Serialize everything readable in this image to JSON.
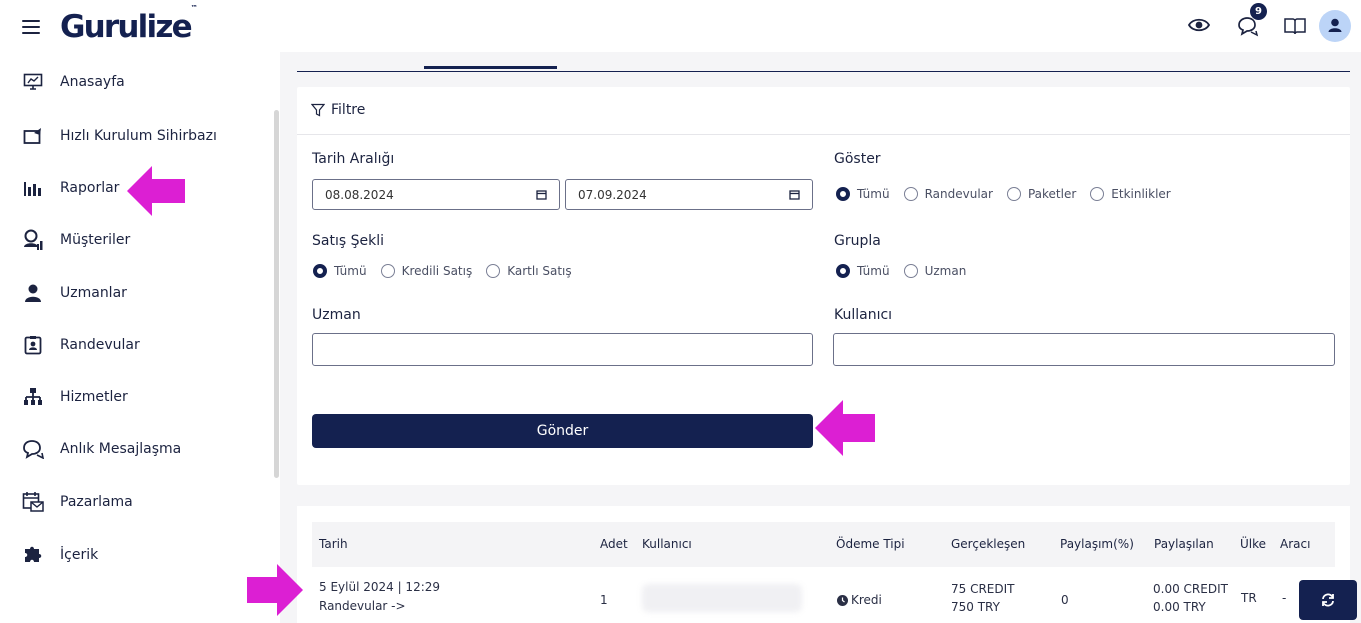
{
  "app": {
    "logo": "Gurulize",
    "logo_tm": "™",
    "notification_count": "9"
  },
  "sidebar": {
    "items": [
      {
        "label": "Anasayfa",
        "icon": "monitor-chart-icon"
      },
      {
        "label": "Hızlı Kurulum Sihirbazı",
        "icon": "setup-wizard-icon"
      },
      {
        "label": "Raporlar",
        "icon": "bar-chart-icon"
      },
      {
        "label": "Müşteriler",
        "icon": "customers-icon"
      },
      {
        "label": "Uzmanlar",
        "icon": "expert-user-icon"
      },
      {
        "label": "Randevular",
        "icon": "appointment-badge-icon"
      },
      {
        "label": "Hizmetler",
        "icon": "hierarchy-icon"
      },
      {
        "label": "Anlık Mesajlaşma",
        "icon": "chat-bubble-icon"
      },
      {
        "label": "Pazarlama",
        "icon": "calendar-mail-icon"
      },
      {
        "label": "İçerik",
        "icon": "puzzle-icon"
      }
    ]
  },
  "filter": {
    "title": "Filtre",
    "date_range_label": "Tarih Aralığı",
    "date_start": "08.08.2024",
    "date_end": "07.09.2024",
    "show_label": "Göster",
    "show_options": [
      "Tümü",
      "Randevular",
      "Paketler",
      "Etkinlikler"
    ],
    "show_selected": "Tümü",
    "sale_type_label": "Satış Şekli",
    "sale_type_options": [
      "Tümü",
      "Kredili Satış",
      "Kartlı Satış"
    ],
    "sale_type_selected": "Tümü",
    "group_label": "Grupla",
    "group_options": [
      "Tümü",
      "Uzman"
    ],
    "group_selected": "Tümü",
    "expert_label": "Uzman",
    "expert_value": "",
    "user_label": "Kullanıcı",
    "user_value": "",
    "submit_label": "Gönder"
  },
  "table": {
    "columns": [
      "Tarih",
      "Adet",
      "Kullanıcı",
      "Ödeme Tipi",
      "Gerçekleşen",
      "Paylaşım(%)",
      "Paylaşılan",
      "Ülke",
      "Aracı"
    ],
    "rows": [
      {
        "date": "5 Eylül 2024 | 12:29",
        "detail": "Randevular -> ",
        "count": "1",
        "user": "",
        "payment": "Kredi",
        "realized_1": "75 CREDIT",
        "realized_2": "750 TRY",
        "share_pct": "0",
        "shared_1": "0.00 CREDIT",
        "shared_2": "0.00 TRY",
        "country": "TR",
        "agent": "-"
      }
    ]
  },
  "colors": {
    "primary": "#142150",
    "annotation_arrow": "#dc1fd3",
    "avatar_bg": "#bcd4f7"
  }
}
